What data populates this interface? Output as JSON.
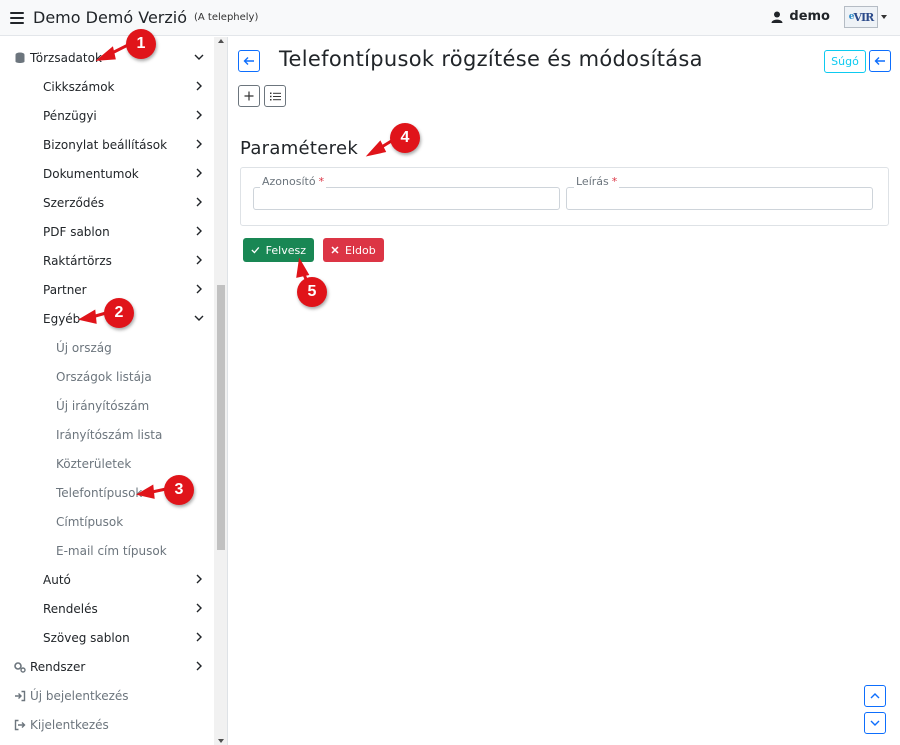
{
  "header": {
    "app_title": "Demo Demó Verzió",
    "app_subtitle": "(A telephely)",
    "user_name": "demo",
    "logo_text": "VIR"
  },
  "sidebar": {
    "items": [
      {
        "label": "Törzsadatok",
        "level": 0,
        "icon": "database-icon",
        "chevron": "down"
      },
      {
        "label": "Cikkszámok",
        "level": 1,
        "chevron": "right"
      },
      {
        "label": "Pénzügyi",
        "level": 1,
        "chevron": "right"
      },
      {
        "label": "Bizonylat beállítások",
        "level": 1,
        "chevron": "right"
      },
      {
        "label": "Dokumentumok",
        "level": 1,
        "chevron": "right"
      },
      {
        "label": "Szerződés",
        "level": 1,
        "chevron": "right"
      },
      {
        "label": "PDF sablon",
        "level": 1,
        "chevron": "right"
      },
      {
        "label": "Raktártörzs",
        "level": 1,
        "chevron": "right"
      },
      {
        "label": "Partner",
        "level": 1,
        "chevron": "right"
      },
      {
        "label": "Egyéb",
        "level": 1,
        "chevron": "down"
      },
      {
        "label": "Új ország",
        "level": 2
      },
      {
        "label": "Országok listája",
        "level": 2
      },
      {
        "label": "Új irányítószám",
        "level": 2
      },
      {
        "label": "Irányítószám lista",
        "level": 2
      },
      {
        "label": "Közterületek",
        "level": 2
      },
      {
        "label": "Telefontípusok",
        "level": 2
      },
      {
        "label": "Címtípusok",
        "level": 2
      },
      {
        "label": "E-mail cím típusok",
        "level": 2
      },
      {
        "label": "Autó",
        "level": 1,
        "chevron": "right"
      },
      {
        "label": "Rendelés",
        "level": 1,
        "chevron": "right"
      },
      {
        "label": "Szöveg sablon",
        "level": 1,
        "chevron": "right"
      },
      {
        "label": "Rendszer",
        "level": 0,
        "icon": "gears-icon",
        "chevron": "right"
      },
      {
        "label": "Új bejelentkezés",
        "level": 0,
        "icon": "login-icon"
      },
      {
        "label": "Kijelentkezés",
        "level": 0,
        "icon": "logout-icon"
      }
    ]
  },
  "main": {
    "page_title": "Telefontípusok rögzítése és módosítása",
    "help_label": "Súgó",
    "section_title": "Paraméterek",
    "fields": {
      "id_label": "Azonosító",
      "id_value": "",
      "desc_label": "Leírás",
      "desc_value": "",
      "required_mark": "*"
    },
    "buttons": {
      "save": "Felvesz",
      "discard": "Eldob"
    }
  },
  "callouts": [
    "1",
    "2",
    "3",
    "4",
    "5"
  ],
  "colors": {
    "primary": "#0d6efd",
    "info": "#0dcaf0",
    "success": "#198754",
    "danger": "#dc3545",
    "callout": "#e0141a"
  }
}
